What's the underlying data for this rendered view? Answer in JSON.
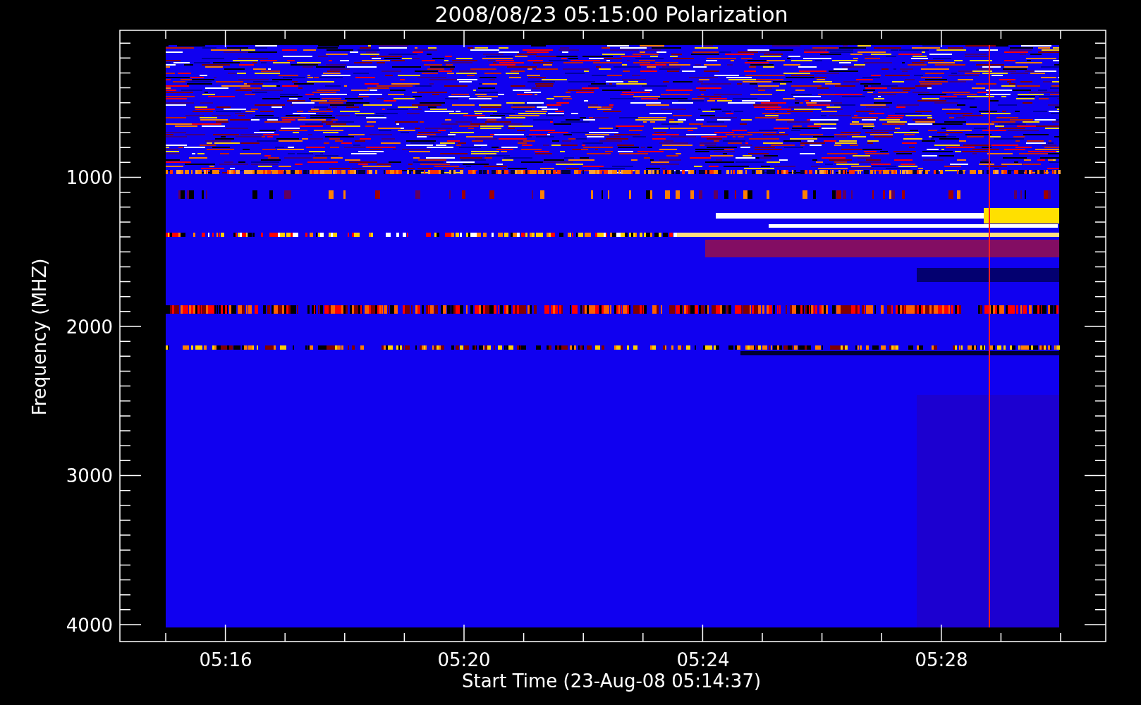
{
  "title": "2008/08/23 05:15:00 Polarization",
  "y_axis": {
    "title": "Frequency (MHZ)",
    "ticks": [
      "1000",
      "2000",
      "3000",
      "4000"
    ]
  },
  "x_axis": {
    "title": "Start Time (23-Aug-08 05:14:37)",
    "ticks": [
      "05:16",
      "05:20",
      "05:24",
      "05:28"
    ]
  }
}
